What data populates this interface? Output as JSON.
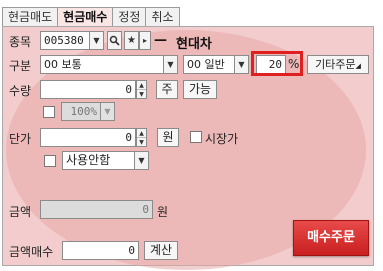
{
  "tabs": [
    {
      "label": "현금매도",
      "active": false
    },
    {
      "label": "현금매수",
      "active": true
    },
    {
      "label": "정정",
      "active": false
    },
    {
      "label": "취소",
      "active": false
    }
  ],
  "stock": {
    "label": "종목",
    "code": "005380",
    "name_prefix": "—",
    "name": "현대차"
  },
  "division": {
    "label": "구분",
    "order_type": "00 보통",
    "condition": "00 일반",
    "percent_value": "20",
    "percent_unit": "%",
    "other_order_label": "기타주문"
  },
  "quantity": {
    "label": "수량",
    "value": "0",
    "unit_button": "주",
    "possible_button": "가능",
    "ratio_value": "100%"
  },
  "price": {
    "label": "단가",
    "value": "0",
    "unit_button": "원",
    "market_price_label": "시장가",
    "usage_option": "사용안함"
  },
  "amount": {
    "label": "금액",
    "value": "0",
    "unit": "원"
  },
  "amount_buy": {
    "label": "금액매수",
    "value": "0",
    "calc_button": "계산"
  },
  "buy_button_label": "매수주문",
  "colors": {
    "panel_bg": "#f3cdcd",
    "buy_button": "#d62f2f",
    "highlight_box": "#e02020"
  }
}
